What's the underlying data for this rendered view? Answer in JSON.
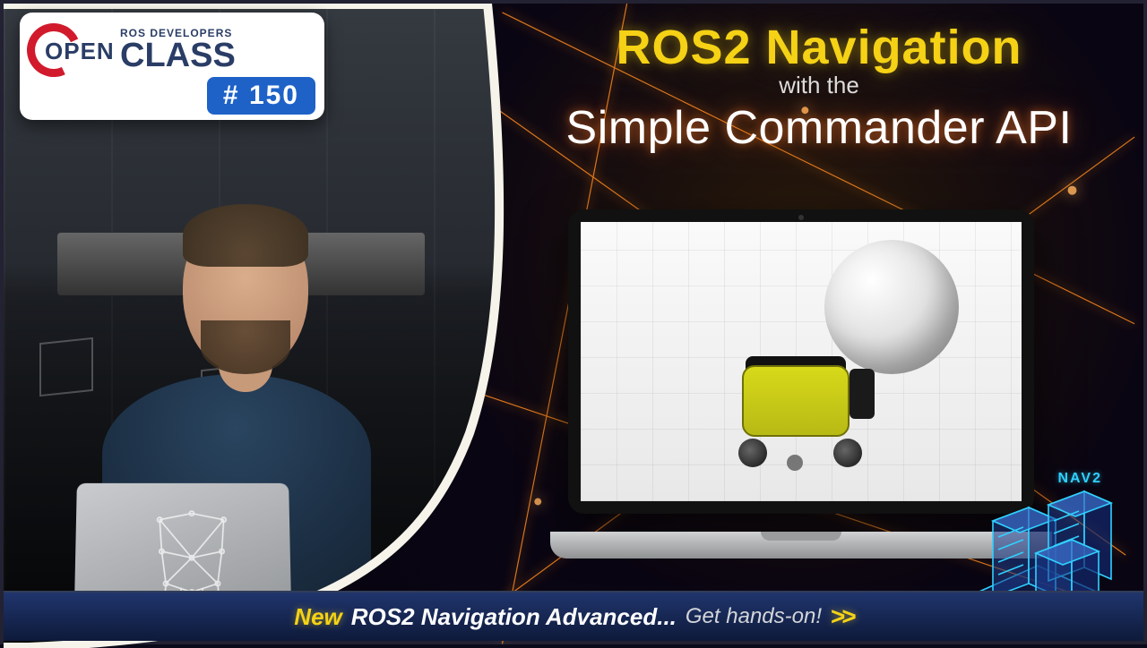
{
  "badge": {
    "open_word": "OPEN",
    "subtitle": "ROS DEVELOPERS",
    "class_word": "CLASS",
    "episode": "# 150"
  },
  "title": {
    "line1": "ROS2 Navigation",
    "line2": "with the",
    "line3": "Simple Commander API"
  },
  "laptop": {
    "scene_desc": "robot-and-sphere-sim"
  },
  "course_bar": {
    "new_label": "New",
    "course_name": "ROS2 Navigation Advanced...",
    "cta": "Get hands-on!",
    "chevrons": ">>"
  },
  "corner_art": {
    "label": "NAV2"
  },
  "colors": {
    "accent_yellow": "#f5d215",
    "accent_orange": "#ff8a1f",
    "brand_blue": "#1e62c8",
    "brand_red": "#d11b2d"
  }
}
